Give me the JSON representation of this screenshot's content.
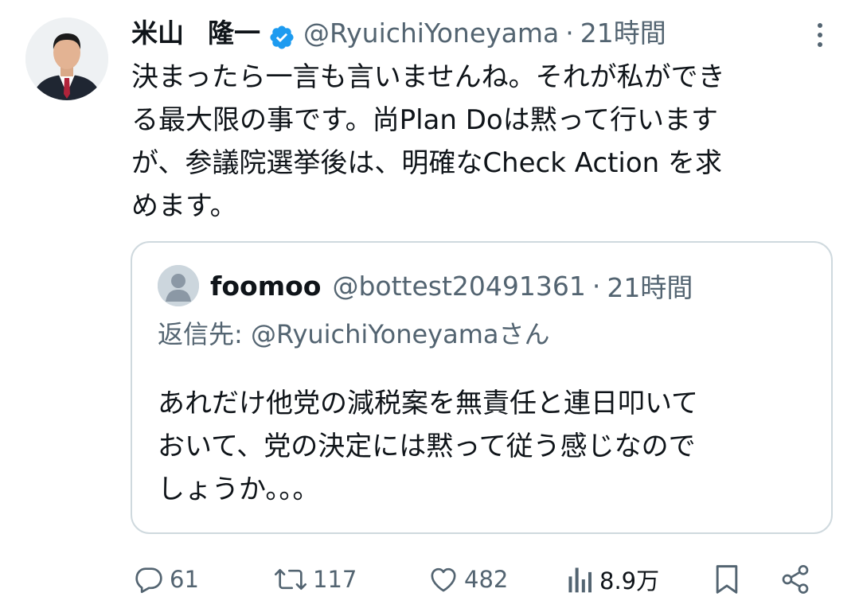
{
  "tweet": {
    "author_name_part1": "米山",
    "author_name_part2": "隆一",
    "handle": "@RyuichiYoneyama",
    "separator": "·",
    "time": "21時間",
    "text": "決まったら一言も言いませんね。それが私ができ\nる最大限の事です。尚Plan Doは黙って行います\nが、参議院選挙後は、明確なCheck Action を求\nめます。",
    "icons": {
      "avatar": "profile-photo",
      "verified": "verified-badge-icon",
      "more": "more-vertical-icon"
    }
  },
  "quoted_tweet": {
    "author_name": "foomoo",
    "handle": "@bottest20491361",
    "separator": "·",
    "time": "21時間",
    "reply_to": "返信先: @RyuichiYoneyamaさん",
    "text": "あれだけ他党の減税案を無責任と連日叩いて\nおいて、党の決定には黙って従う感じなので\nしょうか。。。",
    "icons": {
      "avatar": "default-user-avatar-icon"
    }
  },
  "actions": {
    "reply_count": "61",
    "retweet_count": "117",
    "like_count": "482",
    "view_count": "8.9万",
    "icons": [
      "reply-icon",
      "retweet-icon",
      "like-icon",
      "views-icon",
      "bookmark-icon",
      "share-icon"
    ]
  },
  "colors": {
    "text_primary": "#0f1419",
    "text_secondary": "#536471",
    "verified_blue": "#1d9bf0",
    "border": "#cfd9de"
  }
}
